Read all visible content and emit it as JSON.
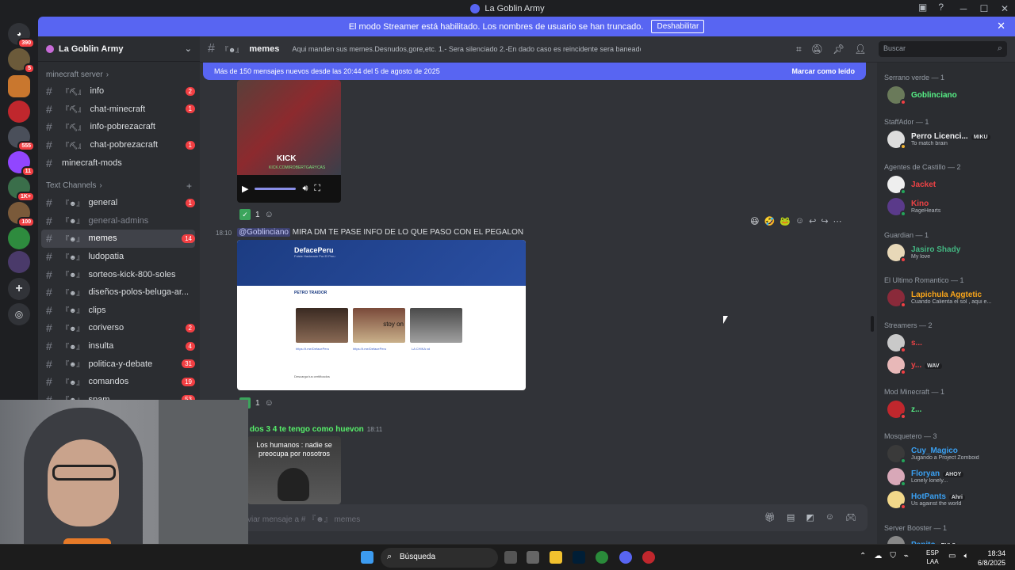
{
  "window": {
    "title": "La Goblin Army"
  },
  "banner": {
    "text": "El modo Streamer está habilitado. Los nombres de usuario se han truncado.",
    "button": "Deshabilitar"
  },
  "rail": {
    "badges": [
      "390",
      "5",
      "555",
      "11",
      "1K+",
      "100"
    ]
  },
  "guild": {
    "name": "La Goblin Army"
  },
  "categories": {
    "minecraft": "minecraft server",
    "text": "Text Channels"
  },
  "channels_minecraft": [
    {
      "prefix": "『⛏』",
      "name": "info",
      "badge": "2"
    },
    {
      "prefix": "『⛏』",
      "name": "chat-minecraft",
      "badge": "1"
    },
    {
      "prefix": "『⛏』",
      "name": "info-pobrezacraft",
      "badge": ""
    },
    {
      "prefix": "『⛏』",
      "name": "chat-pobrezacraft",
      "badge": "1"
    },
    {
      "prefix": "",
      "name": "minecraft-mods",
      "badge": ""
    }
  ],
  "channels_text": [
    {
      "prefix": "『☻』",
      "name": "general",
      "badge": "1"
    },
    {
      "prefix": "『☻』",
      "name": "general-admins",
      "badge": ""
    },
    {
      "prefix": "『☻』",
      "name": "memes",
      "badge": "14"
    },
    {
      "prefix": "『☻』",
      "name": "ludopatia",
      "badge": ""
    },
    {
      "prefix": "『☻』",
      "name": "sorteos-kick-800-soles",
      "badge": ""
    },
    {
      "prefix": "『☻』",
      "name": "diseños-polos-beluga-ar...",
      "badge": ""
    },
    {
      "prefix": "『☻』",
      "name": "clips",
      "badge": ""
    },
    {
      "prefix": "『☻』",
      "name": "coriverso",
      "badge": "2"
    },
    {
      "prefix": "『☻』",
      "name": "insulta",
      "badge": "4"
    },
    {
      "prefix": "『☻』",
      "name": "politica-y-debate",
      "badge": "31"
    },
    {
      "prefix": "『☻』",
      "name": "comandos",
      "badge": "19"
    },
    {
      "prefix": "『☻』",
      "name": "spam",
      "badge": "53"
    }
  ],
  "header": {
    "channel_prefix": "『☻』",
    "channel": "memes",
    "topic": "Aqui manden sus memes.Desnudos,gore,etc. 1.- Sera silenciado 2.-En dado caso es reincidente sera baneado",
    "search_placeholder": "Buscar"
  },
  "newbar": {
    "text": "Más de 150 mensajes nuevos desde las 20:44 del 5 de agosto de 2025",
    "action": "Marcar como leído"
  },
  "video": {
    "brand": "KICK",
    "url": "KICK.COM/ROBERTGARYCAS"
  },
  "reactions": {
    "count1": "1",
    "count2": "1"
  },
  "message2": {
    "time": "18:10",
    "mention": "@Goblinciano",
    "text": "MIRA DM TE PASE INFO DE LO QUE PASO CON EL PEGALON"
  },
  "site": {
    "brand": "DefacePeru",
    "subtitle": "Fuiste Hackeado Por El Peru",
    "section": "PETRO TRAIDOR",
    "links": [
      "https://t.me/DefacePeru",
      "https://t.me/DefacePeru",
      "LA CHIKA xd"
    ],
    "footer": "Descarga tus certificados",
    "overlay": "stoy on"
  },
  "message3": {
    "text": "o dos 3 4 te tengo como huevon",
    "time": "18:11"
  },
  "meme": {
    "caption": "Los humanos : nadie se preocupa por nosotros"
  },
  "composer": {
    "placeholder": "viar mensaje a # 『☻』 memes"
  },
  "members": {
    "roles": [
      "Serrano verde — 1",
      "StaffAdor — 1",
      "Agentes de Castillo — 2",
      "Guardian — 1",
      "El Ultimo Romantico — 1",
      "Streamers — 2",
      "Mod Minecraft — 1",
      "Mosquetero — 3",
      "Server Booster — 1"
    ],
    "list": [
      {
        "name": "Goblinciano",
        "status": "",
        "tag": "",
        "color": "#57f287"
      },
      {
        "name": "Perro Licenci...",
        "status": "To match brain",
        "tag": "MIKU",
        "color": "#f2f3f5"
      },
      {
        "name": "Jacket",
        "status": "",
        "tag": "",
        "color": "#ed4245"
      },
      {
        "name": "Kino",
        "status": "RageHearts",
        "tag": "",
        "color": "#ed4245"
      },
      {
        "name": "Jasiro Shady",
        "status": "My love",
        "tag": "",
        "color": "#43b581"
      },
      {
        "name": "Lapichula Aggtetic",
        "status": "Cuando Calienta el sol , aqui e...",
        "tag": "",
        "color": "#faa61a"
      },
      {
        "name": "s...",
        "status": "",
        "tag": "",
        "color": "#ed4245"
      },
      {
        "name": "y...",
        "status": "",
        "tag": "WAV",
        "color": "#ed4245"
      },
      {
        "name": "z...",
        "status": "",
        "tag": "",
        "color": "#57f287"
      },
      {
        "name": "Cuy_Magico",
        "status": "Jugando a Project Zomboid",
        "tag": "",
        "color": "#3aa0f2"
      },
      {
        "name": "Floryan",
        "status": "Lonely lonely...",
        "tag": "AHOY",
        "color": "#3aa0f2"
      },
      {
        "name": "HotPants",
        "status": "Us against the world",
        "tag": "Ahri",
        "color": "#3aa0f2"
      },
      {
        "name": "Pepito",
        "status": "",
        "tag": "RVLS",
        "color": "#3aa0f2"
      }
    ]
  },
  "taskbar": {
    "search": "Búsqueda",
    "lang1": "ESP",
    "lang2": "LAA",
    "time": "18:34",
    "date": "6/8/2025"
  }
}
